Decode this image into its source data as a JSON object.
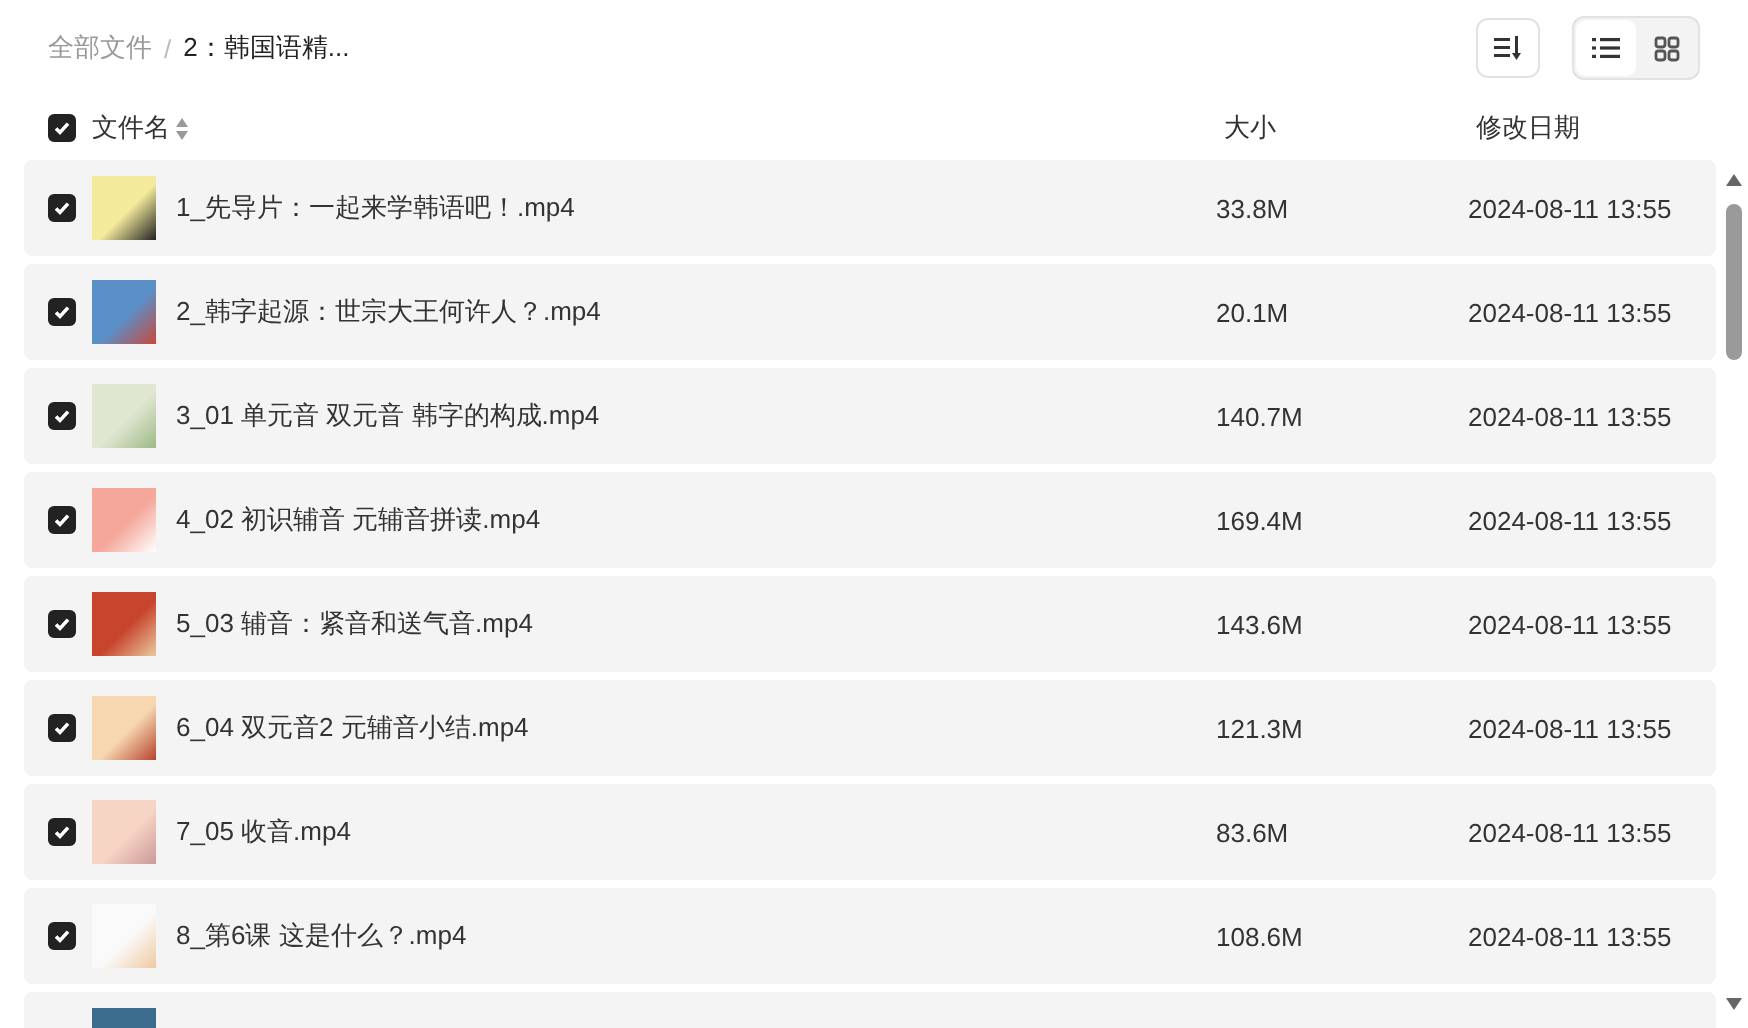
{
  "breadcrumb": [
    {
      "label": "全部文件",
      "current": false
    },
    {
      "label": "2：韩国语精...",
      "current": true
    }
  ],
  "separator": "/",
  "toolbar": {
    "view_modes": [
      {
        "kind": "list",
        "selected": true
      },
      {
        "kind": "grid",
        "selected": false
      }
    ]
  },
  "header": {
    "checked": true,
    "columns": [
      "文件名",
      "大小",
      "修改日期"
    ]
  },
  "rows": [
    {
      "name": "1_先导片：一起来学韩语吧！.mp4",
      "size": "33.8M",
      "modified": "2024-08-11 13:55",
      "checked": true
    },
    {
      "name": "2_韩字起源：世宗大王何许人？.mp4",
      "size": "20.1M",
      "modified": "2024-08-11 13:55",
      "checked": true
    },
    {
      "name": "3_01 单元音 双元音 韩字的构成.mp4",
      "size": "140.7M",
      "modified": "2024-08-11 13:55",
      "checked": true
    },
    {
      "name": "4_02 初识辅音 元辅音拼读.mp4",
      "size": "169.4M",
      "modified": "2024-08-11 13:55",
      "checked": true
    },
    {
      "name": "5_03 辅音：紧音和送气音.mp4",
      "size": "143.6M",
      "modified": "2024-08-11 13:55",
      "checked": true
    },
    {
      "name": "6_04 双元音2 元辅音小结.mp4",
      "size": "121.3M",
      "modified": "2024-08-11 13:55",
      "checked": true
    },
    {
      "name": "7_05 收音.mp4",
      "size": "83.6M",
      "modified": "2024-08-11 13:55",
      "checked": true
    },
    {
      "name": "8_第6课 这是什么？.mp4",
      "size": "108.6M",
      "modified": "2024-08-11 13:55",
      "checked": true
    }
  ]
}
